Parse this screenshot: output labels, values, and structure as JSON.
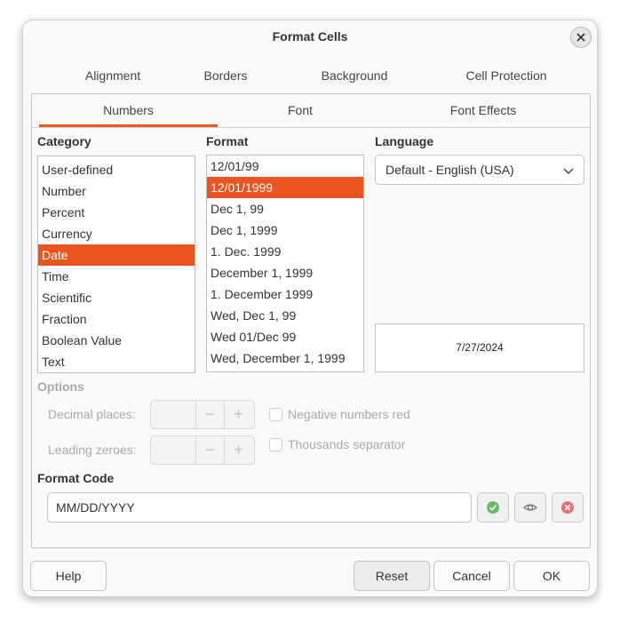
{
  "window": {
    "title": "Format Cells"
  },
  "tabs_top": [
    "Alignment",
    "Borders",
    "Background",
    "Cell Protection"
  ],
  "tabs_second": [
    "Numbers",
    "Font",
    "Font Effects"
  ],
  "category": {
    "label": "Category",
    "items": [
      "User-defined",
      "Number",
      "Percent",
      "Currency",
      "Date",
      "Time",
      "Scientific",
      "Fraction",
      "Boolean Value",
      "Text"
    ],
    "selected_index": 4
  },
  "format": {
    "label": "Format",
    "items": [
      "12/01/99",
      "12/01/1999",
      "Dec 1, 99",
      "Dec 1, 1999",
      "1. Dec. 1999",
      "December 1, 1999",
      "1. December 1999",
      "Wed, Dec 1, 99",
      "Wed 01/Dec 99",
      "Wed, December 1, 1999"
    ],
    "selected_index": 1
  },
  "language": {
    "label": "Language",
    "value": "Default - English (USA)"
  },
  "preview": {
    "value": "7/27/2024"
  },
  "options": {
    "label": "Options",
    "decimal_places_label": "Decimal places:",
    "leading_zeroes_label": "Leading zeroes:",
    "negative_red_label": "Negative numbers red",
    "thousands_sep_label": "Thousands separator",
    "minus": "−",
    "plus": "+"
  },
  "format_code": {
    "label": "Format Code",
    "value": "MM/DD/YYYY"
  },
  "buttons": {
    "help": "Help",
    "reset": "Reset",
    "cancel": "Cancel",
    "ok": "OK"
  },
  "colors": {
    "accent": "#e95420",
    "ok_green": "#66bb6a",
    "delete_red": "#e57373"
  }
}
